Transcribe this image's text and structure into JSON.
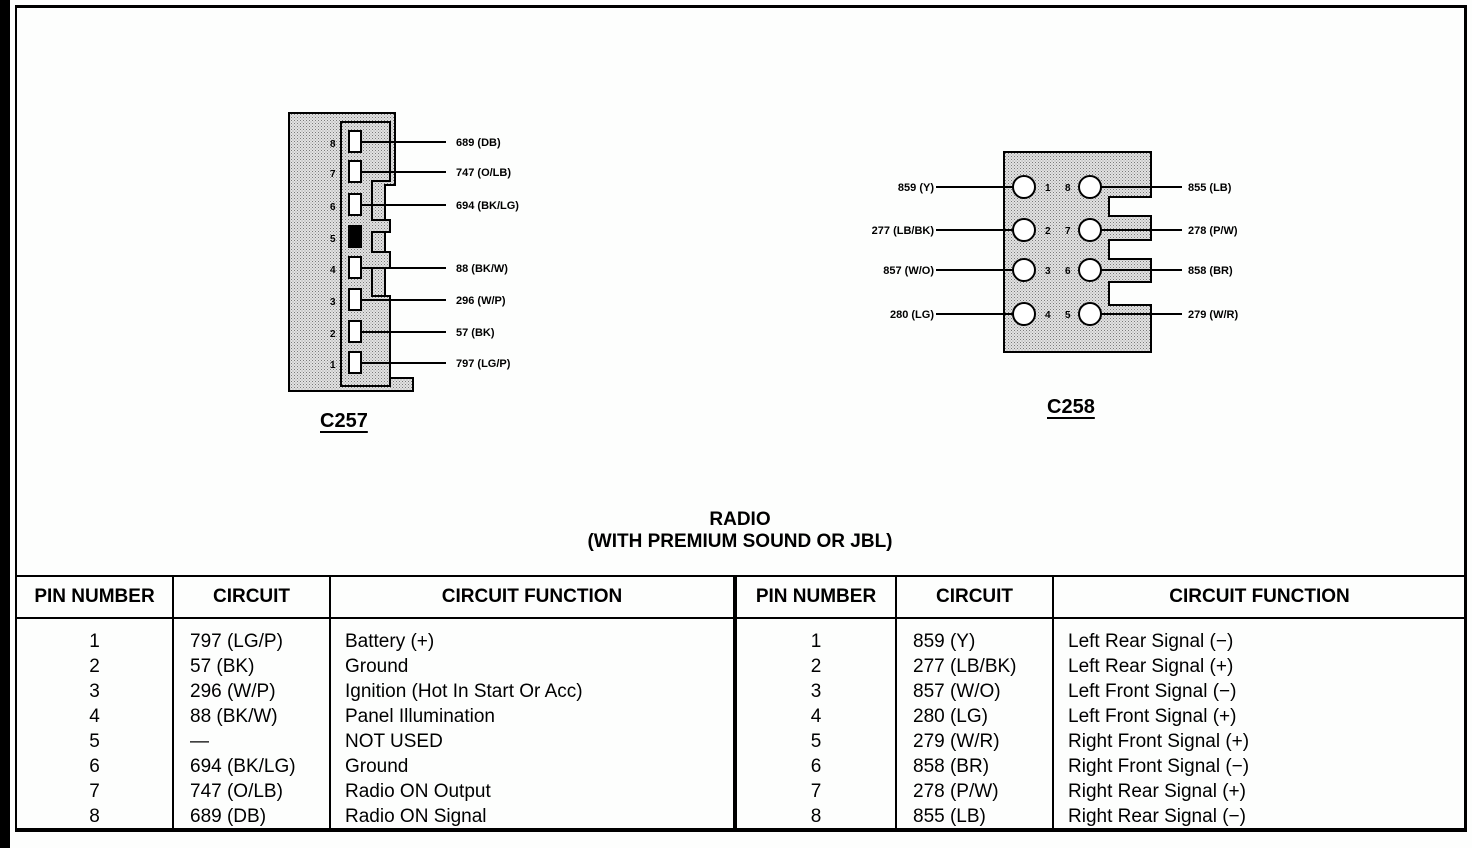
{
  "title": {
    "line1": "RADIO",
    "line2": "(WITH PREMIUM SOUND OR JBL)"
  },
  "connectors": {
    "c257": {
      "label": "C257",
      "cavities": [
        {
          "pin": "8",
          "wire": "689 (DB)"
        },
        {
          "pin": "7",
          "wire": "747 (O/LB)"
        },
        {
          "pin": "6",
          "wire": "694 (BK/LG)"
        },
        {
          "pin": "5",
          "wire": "",
          "blocked": true
        },
        {
          "pin": "4",
          "wire": "88 (BK/W)"
        },
        {
          "pin": "3",
          "wire": "296 (W/P)"
        },
        {
          "pin": "2",
          "wire": "57 (BK)"
        },
        {
          "pin": "1",
          "wire": "797 (LG/P)"
        }
      ]
    },
    "c258": {
      "label": "C258",
      "left": [
        {
          "pin": "1",
          "wire": "859 (Y)"
        },
        {
          "pin": "2",
          "wire": "277 (LB/BK)"
        },
        {
          "pin": "3",
          "wire": "857 (W/O)"
        },
        {
          "pin": "4",
          "wire": "280 (LG)"
        }
      ],
      "right": [
        {
          "pin": "8",
          "wire": "855 (LB)"
        },
        {
          "pin": "7",
          "wire": "278 (P/W)"
        },
        {
          "pin": "6",
          "wire": "858 (BR)"
        },
        {
          "pin": "5",
          "wire": "279 (W/R)"
        }
      ]
    }
  },
  "tables": [
    {
      "headers": {
        "pin": "PIN NUMBER",
        "circuit": "CIRCUIT",
        "function": "CIRCUIT FUNCTION"
      },
      "rows": [
        {
          "pin": "1",
          "circuit": "797 (LG/P)",
          "function": "Battery (+)"
        },
        {
          "pin": "2",
          "circuit": "57 (BK)",
          "function": "Ground"
        },
        {
          "pin": "3",
          "circuit": "296 (W/P)",
          "function": "Ignition (Hot In Start Or Acc)"
        },
        {
          "pin": "4",
          "circuit": "88 (BK/W)",
          "function": "Panel Illumination"
        },
        {
          "pin": "5",
          "circuit": "—",
          "function": "NOT USED"
        },
        {
          "pin": "6",
          "circuit": "694 (BK/LG)",
          "function": "Ground"
        },
        {
          "pin": "7",
          "circuit": "747 (O/LB)",
          "function": "Radio ON Output"
        },
        {
          "pin": "8",
          "circuit": "689 (DB)",
          "function": "Radio ON Signal"
        }
      ]
    },
    {
      "headers": {
        "pin": "PIN NUMBER",
        "circuit": "CIRCUIT",
        "function": "CIRCUIT FUNCTION"
      },
      "rows": [
        {
          "pin": "1",
          "circuit": "859 (Y)",
          "function": "Left Rear Signal (−)"
        },
        {
          "pin": "2",
          "circuit": "277 (LB/BK)",
          "function": "Left Rear Signal (+)"
        },
        {
          "pin": "3",
          "circuit": "857 (W/O)",
          "function": "Left Front Signal (−)"
        },
        {
          "pin": "4",
          "circuit": "280 (LG)",
          "function": "Left Front Signal (+)"
        },
        {
          "pin": "5",
          "circuit": "279 (W/R)",
          "function": "Right Front Signal (+)"
        },
        {
          "pin": "6",
          "circuit": "858 (BR)",
          "function": "Right Front Signal (−)"
        },
        {
          "pin": "7",
          "circuit": "278 (P/W)",
          "function": "Right Rear Signal (+)"
        },
        {
          "pin": "8",
          "circuit": "855 (LB)",
          "function": "Right Rear Signal (−)"
        }
      ]
    }
  ]
}
